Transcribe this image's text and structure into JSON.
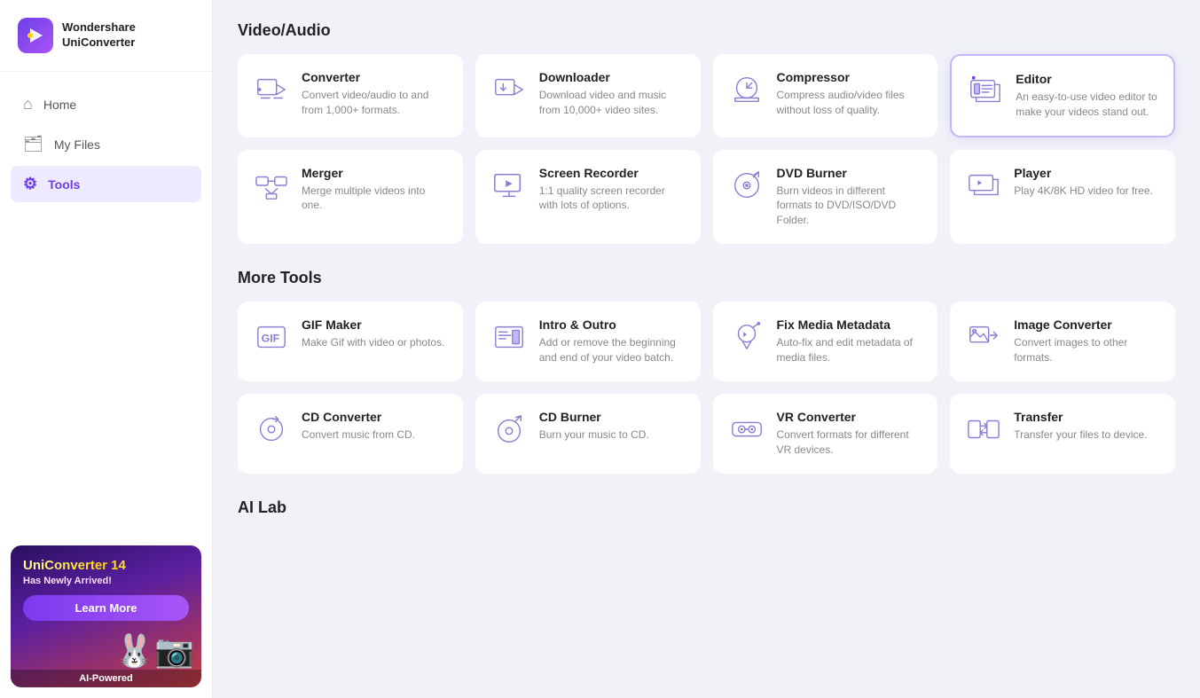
{
  "app": {
    "name": "Wondershare",
    "product": "UniConverter"
  },
  "nav": {
    "items": [
      {
        "id": "home",
        "label": "Home",
        "icon": "home"
      },
      {
        "id": "myfiles",
        "label": "My Files",
        "icon": "files"
      },
      {
        "id": "tools",
        "label": "Tools",
        "icon": "tools",
        "active": true
      }
    ]
  },
  "banner": {
    "line1": "UniConverter 14",
    "line2": "Has Newly Arrived!",
    "btn_label": "Learn More",
    "footer": "AI-Powered"
  },
  "sections": {
    "video_audio": {
      "title": "Video/Audio",
      "tools": [
        {
          "id": "converter",
          "name": "Converter",
          "desc": "Convert video/audio to and from 1,000+ formats."
        },
        {
          "id": "downloader",
          "name": "Downloader",
          "desc": "Download video and music from 10,000+ video sites."
        },
        {
          "id": "compressor",
          "name": "Compressor",
          "desc": "Compress audio/video files without loss of quality."
        },
        {
          "id": "editor",
          "name": "Editor",
          "desc": "An easy-to-use video editor to make your videos stand out.",
          "highlighted": true
        },
        {
          "id": "merger",
          "name": "Merger",
          "desc": "Merge multiple videos into one."
        },
        {
          "id": "screen-recorder",
          "name": "Screen Recorder",
          "desc": "1:1 quality screen recorder with lots of options."
        },
        {
          "id": "dvd-burner",
          "name": "DVD Burner",
          "desc": "Burn videos in different formats to DVD/ISO/DVD Folder."
        },
        {
          "id": "player",
          "name": "Player",
          "desc": "Play 4K/8K HD video for free."
        }
      ]
    },
    "more_tools": {
      "title": "More Tools",
      "tools": [
        {
          "id": "gif-maker",
          "name": "GIF Maker",
          "desc": "Make Gif with video or photos."
        },
        {
          "id": "intro-outro",
          "name": "Intro & Outro",
          "desc": "Add or remove the beginning and end of your video batch."
        },
        {
          "id": "fix-metadata",
          "name": "Fix Media Metadata",
          "desc": "Auto-fix and edit metadata of media files."
        },
        {
          "id": "image-converter",
          "name": "Image Converter",
          "desc": "Convert images to other formats."
        },
        {
          "id": "cd-converter",
          "name": "CD Converter",
          "desc": "Convert music from CD."
        },
        {
          "id": "cd-burner",
          "name": "CD Burner",
          "desc": "Burn your music to CD."
        },
        {
          "id": "vr-converter",
          "name": "VR Converter",
          "desc": "Convert formats for different VR devices."
        },
        {
          "id": "transfer",
          "name": "Transfer",
          "desc": "Transfer your files to device."
        }
      ]
    },
    "ai_lab": {
      "title": "AI Lab"
    }
  }
}
